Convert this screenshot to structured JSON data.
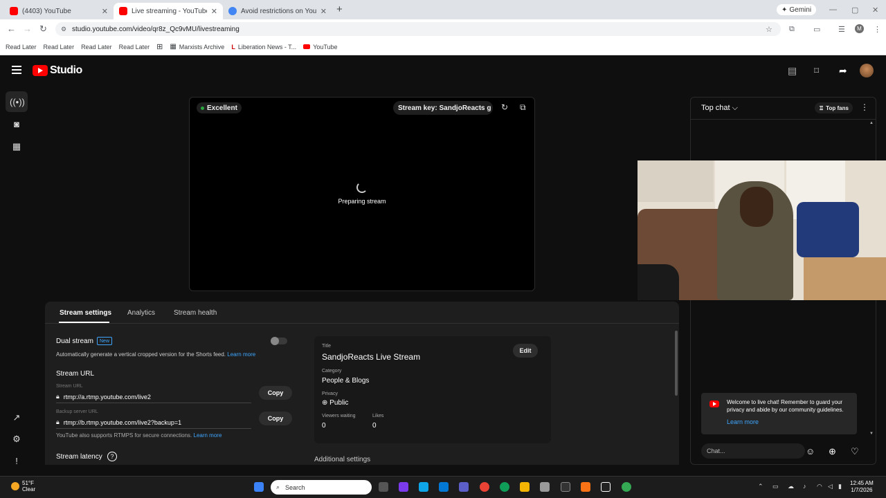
{
  "browser": {
    "tabs": [
      {
        "title": "(4403) YouTube",
        "fav_color": "#ff0000"
      },
      {
        "title": "Live streaming - YouTube Studi",
        "fav_color": "#ff0000"
      },
      {
        "title": "Avoid restrictions on YouTube",
        "fav_color": "#4285f4"
      }
    ],
    "gemini_label": "Gemini",
    "url": "studio.youtube.com/video/qr8z_Qc9vMU/livestreaming",
    "bookmarks": [
      "Read Later",
      "Read Later",
      "Read Later",
      "Read Later",
      "Marxists Archive",
      "Liberation News - T...",
      "YouTube"
    ]
  },
  "studio": {
    "logo_text": "Studio"
  },
  "preview": {
    "status": "Excellent",
    "stream_key_label": "Stream key: SandjoReacts g",
    "preparing": "Preparing stream"
  },
  "panel": {
    "tabs": [
      "Stream settings",
      "Analytics",
      "Stream health"
    ],
    "dual_stream": "Dual stream",
    "new_badge": "New",
    "dual_desc": "Automatically generate a vertical cropped version for the Shorts feed.",
    "learn_more": "Learn more",
    "stream_url_heading": "Stream URL",
    "stream_url_label": "Stream URL",
    "stream_url": "rtmp://a.rtmp.youtube.com/live2",
    "backup_label": "Backup server URL",
    "backup_url": "rtmp://b.rtmp.youtube.com/live2?backup=1",
    "copy": "Copy",
    "rtmps_note": "YouTube also supports RTMPS for secure connections.",
    "latency": "Stream latency",
    "info": {
      "title_label": "Title",
      "title": "SandjoReacts Live Stream",
      "category_label": "Category",
      "category": "People & Blogs",
      "privacy_label": "Privacy",
      "privacy": "Public",
      "viewers_label": "Viewers waiting",
      "viewers": "0",
      "likes_label": "Likes",
      "likes": "0",
      "edit": "Edit"
    },
    "additional": "Additional settings"
  },
  "chat": {
    "mode": "Top chat",
    "top_fans": "Top fans",
    "welcome": "Welcome to live chat! Remember to guard your privacy and abide by our community guidelines.",
    "learn_more": "Learn more",
    "placeholder": "Chat..."
  },
  "taskbar": {
    "temp": "51°F",
    "condition": "Clear",
    "search": "Search",
    "time": "12:45 AM",
    "date": "1/7/2026"
  }
}
